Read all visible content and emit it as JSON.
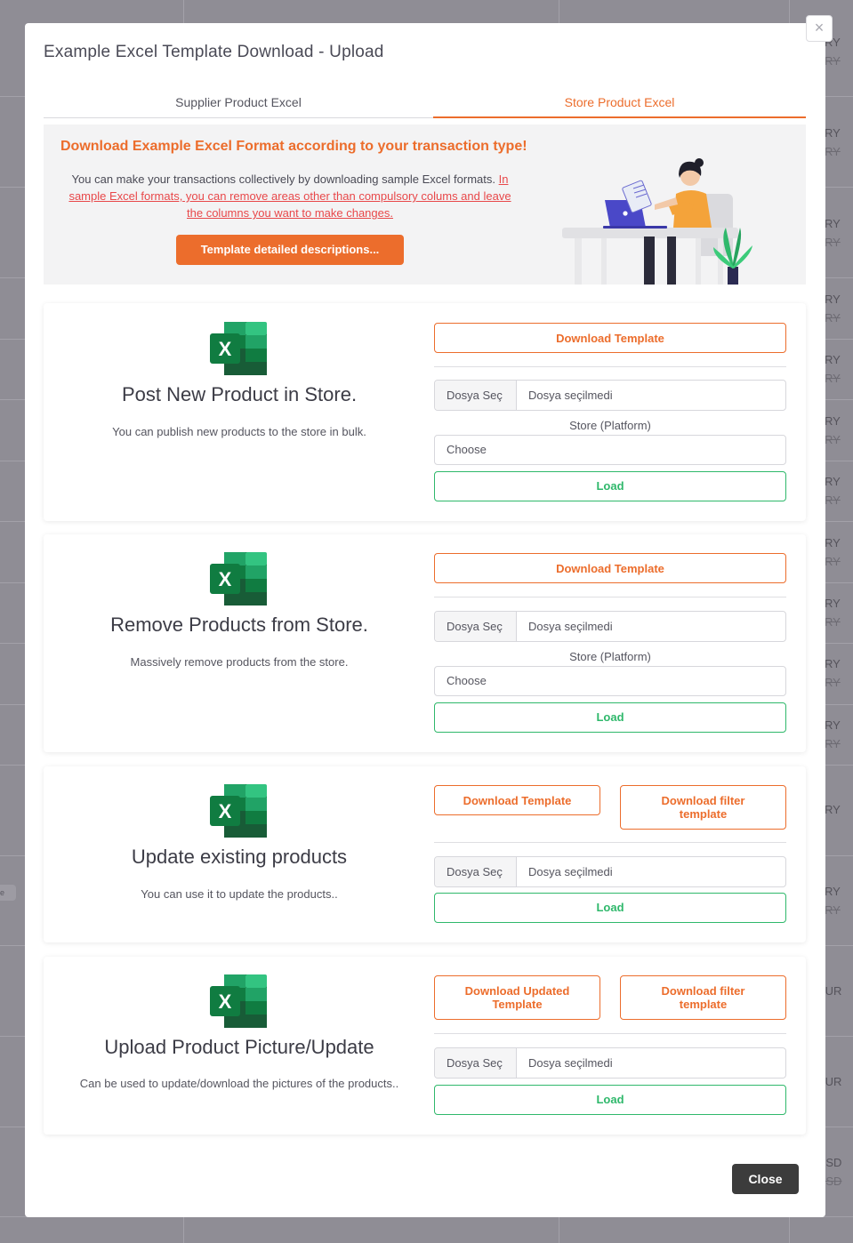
{
  "background": {
    "prices": [
      {
        "cur": "TRY",
        "old": "TRY"
      },
      {
        "cur": "TRY",
        "old": "TRY"
      },
      {
        "cur": "TRY",
        "old": "TRY"
      },
      {
        "cur": "TRY",
        "old": "TRY"
      },
      {
        "cur": "TRY",
        "old": "TRY"
      },
      {
        "cur": "TRY",
        "old": "TRY"
      },
      {
        "cur": "TRY",
        "old": "TRY"
      },
      {
        "cur": "TRY",
        "old": "TRY"
      },
      {
        "cur": "TRY",
        "old": "TRY"
      },
      {
        "cur": "TRY",
        "old": "TRY"
      },
      {
        "cur": "TRY",
        "old": "TRY"
      },
      {
        "cur": "TRY",
        "old": ""
      },
      {
        "cur": "TRY",
        "old": "TRY"
      },
      {
        "cur": "EUR",
        "old": ""
      },
      {
        "cur": "EUR",
        "old": ""
      },
      {
        "cur": "USD",
        "old": "USD"
      }
    ],
    "tag": "e"
  },
  "modal": {
    "title": "Example Excel Template Download - Upload",
    "close_x": "×",
    "tabs": [
      {
        "label": "Supplier Product Excel",
        "active": false
      },
      {
        "label": "Store Product Excel",
        "active": true
      }
    ],
    "banner": {
      "title": "Download Example Excel Format according to your transaction type!",
      "text": "You can make your transactions collectively by downloading sample Excel formats.",
      "link_text": "In sample Excel formats, you can remove areas other than compulsory colums and leave the columns you want to make changes.",
      "button": "Template detailed descriptions..."
    },
    "cards": [
      {
        "title": "Post New Product in Store.",
        "description": "You can publish new products to the store in bulk.",
        "download_template": "Download Template",
        "file_button": "Dosya Seç",
        "file_name": "Dosya seçilmedi",
        "store_label": "Store (Platform)",
        "store_select": "Choose",
        "load": "Load"
      },
      {
        "title": "Remove Products from Store.",
        "description": "Massively remove products from the store.",
        "download_template": "Download Template",
        "file_button": "Dosya Seç",
        "file_name": "Dosya seçilmedi",
        "store_label": "Store (Platform)",
        "store_select": "Choose",
        "load": "Load"
      },
      {
        "title": "Update existing products",
        "description": "You can use it to update the products..",
        "download_template": "Download Template",
        "download_filter": "Download filter template",
        "file_button": "Dosya Seç",
        "file_name": "Dosya seçilmedi",
        "load": "Load"
      },
      {
        "title": "Upload Product Picture/Update",
        "description": "Can be used to update/download the pictures of the products..",
        "download_template": "Download Updated Template",
        "download_filter": "Download filter template",
        "file_button": "Dosya Seç",
        "file_name": "Dosya seçilmedi",
        "load": "Load"
      }
    ],
    "close_button": "Close"
  },
  "colors": {
    "accent": "#ec6d2c",
    "success": "#2fb86b",
    "link": "#e8484a",
    "close_bg": "#3c3c3c",
    "excel_green": "#1f7a45"
  },
  "icons": [
    "close-icon",
    "excel-icon"
  ]
}
